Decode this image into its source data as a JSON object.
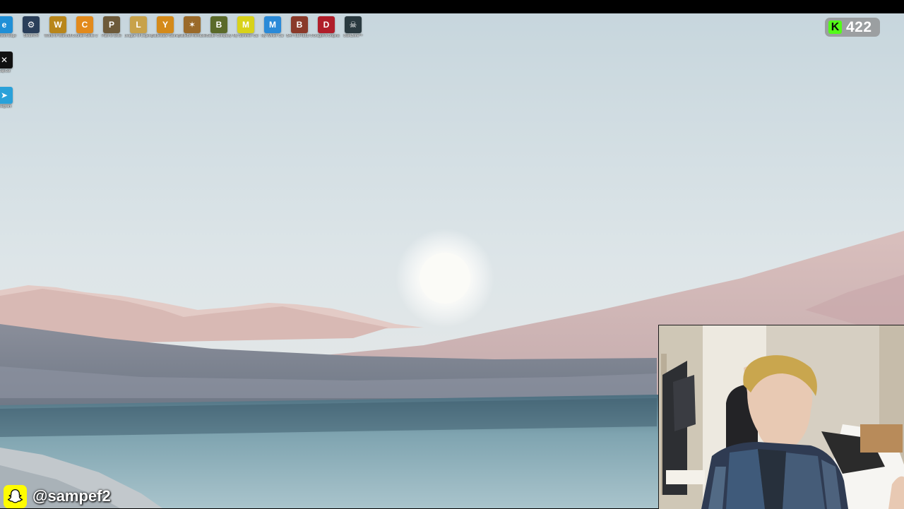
{
  "desktop": {
    "top_row_icons": [
      {
        "name": "edge-icon",
        "label": "…icrosoft Edge",
        "color": "#1f8fd6",
        "glyph": "e"
      },
      {
        "name": "steam-icon",
        "label": "SteamVR",
        "color": "#2a3f5a",
        "glyph": "⚙"
      },
      {
        "name": "world-of-warcraft-icon",
        "label": "World of Warcraft",
        "color": "#b8861b",
        "glyph": "W"
      },
      {
        "name": "counter-strike-icon",
        "label": "Counter-Strike 2",
        "color": "#e28a1c",
        "glyph": "C"
      },
      {
        "name": "path-of-exile-icon",
        "label": "Path of Exile",
        "color": "#6d5a3a",
        "glyph": "P"
      },
      {
        "name": "league-of-legends-icon",
        "label": "League of Legends",
        "color": "#c8a24a",
        "glyph": "L"
      },
      {
        "name": "battlestate-icon",
        "label": "Battlestate Games",
        "color": "#d48a1a",
        "glyph": "Y"
      },
      {
        "name": "battlebit-icon",
        "label": "BattleBit Remastered",
        "color": "#9a6a2a",
        "glyph": "✶"
      },
      {
        "name": "battle-company-icon",
        "label": "Battle Company",
        "color": "#5a6a2a",
        "glyph": "B"
      },
      {
        "name": "my-summer-car-icon",
        "label": "My Summer Car",
        "color": "#d8d21a",
        "glyph": "M"
      },
      {
        "name": "my-winter-car-icon",
        "label": "My Winter Car",
        "color": "#2a8ad8",
        "glyph": "M"
      },
      {
        "name": "battlefield-icon",
        "label": "BATTLEFIELD 3",
        "color": "#8a3a2a",
        "glyph": "B"
      },
      {
        "name": "dragon-game-icon",
        "label": "Dragon's Dogma",
        "color": "#b01e2a",
        "glyph": "D"
      },
      {
        "name": "dark-game-icon",
        "label": "DarkZone™",
        "color": "#2a3a40",
        "glyph": "☠"
      }
    ],
    "left_column_icons": [
      {
        "name": "capcut-icon",
        "label": "CapCut",
        "color": "#111111",
        "glyph": "✕"
      },
      {
        "name": "telegram-icon",
        "label": "Telegram",
        "color": "#2aa1d9",
        "glyph": "➤"
      }
    ]
  },
  "overlay": {
    "kick_viewer_count": "422",
    "kick_logo_glyph": "K",
    "kick_color": "#53fc18",
    "snapchat_handle": "@sampef2",
    "snapchat_color": "#fffc00"
  }
}
